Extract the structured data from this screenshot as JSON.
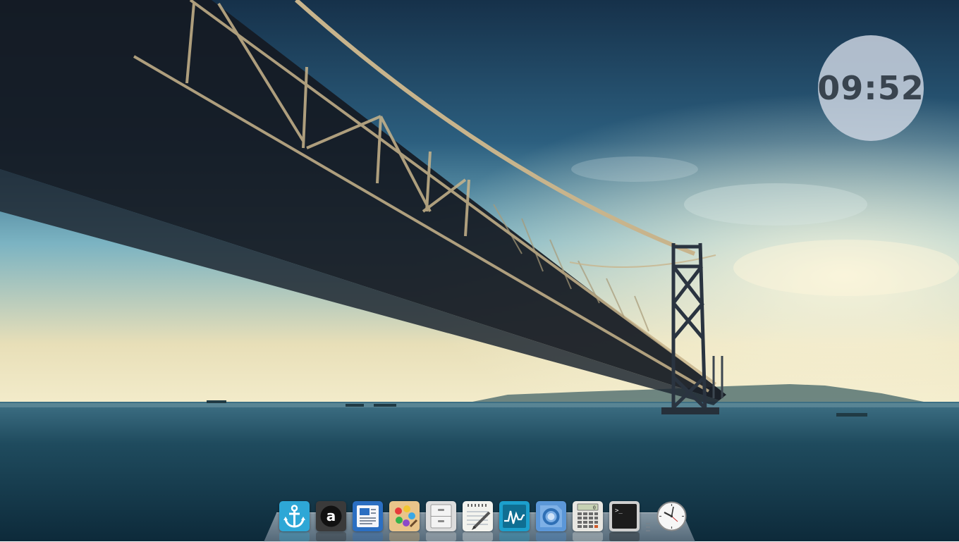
{
  "desktop": {
    "clock_widget": {
      "time": "09:52"
    }
  },
  "dock": {
    "items": [
      {
        "name": "anchor-icon",
        "color": "#2fa8d8"
      },
      {
        "name": "a-letter-icon",
        "color": "#2a2a2a"
      },
      {
        "name": "document-viewer-icon",
        "color": "#2b6fc2"
      },
      {
        "name": "paint-palette-icon",
        "color": "#e8b56c"
      },
      {
        "name": "file-cabinet-icon",
        "color": "#d8d8d8"
      },
      {
        "name": "notepad-pencil-icon",
        "color": "#f5f5f0"
      },
      {
        "name": "system-monitor-icon",
        "color": "#1fa3d0"
      },
      {
        "name": "web-browser-icon",
        "color": "#4a90d9"
      },
      {
        "name": "calculator-icon",
        "color": "#e7e7e2"
      },
      {
        "name": "terminal-icon",
        "color": "#1e1e1e"
      },
      {
        "name": "clock-icon",
        "color": "#f0f0f0"
      }
    ]
  }
}
